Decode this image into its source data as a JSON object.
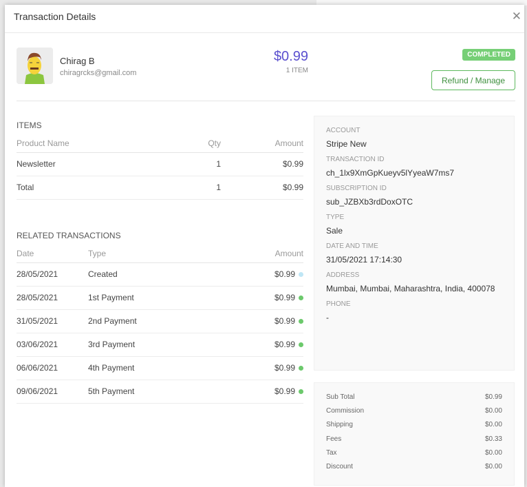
{
  "title": "Transaction Details",
  "customer": {
    "name": "Chirag B",
    "email": "chiragrcks@gmail.com"
  },
  "amount": "$0.99",
  "item_count": "1 ITEM",
  "status": "COMPLETED",
  "refund_label": "Refund / Manage",
  "items": {
    "heading": "ITEMS",
    "headers": [
      "Product Name",
      "Qty",
      "Amount"
    ],
    "rows": [
      {
        "name": "Newsletter",
        "qty": "1",
        "amount": "$0.99"
      },
      {
        "name": "Total",
        "qty": "1",
        "amount": "$0.99"
      }
    ]
  },
  "related": {
    "heading": "RELATED TRANSACTIONS",
    "headers": [
      "Date",
      "Type",
      "Amount"
    ],
    "rows": [
      {
        "date": "28/05/2021",
        "type": "Created",
        "amount": "$0.99",
        "color": "#bfe6f5"
      },
      {
        "date": "28/05/2021",
        "type": "1st Payment",
        "amount": "$0.99",
        "color": "#6cc96c"
      },
      {
        "date": "31/05/2021",
        "type": "2nd Payment",
        "amount": "$0.99",
        "color": "#6cc96c"
      },
      {
        "date": "03/06/2021",
        "type": "3rd Payment",
        "amount": "$0.99",
        "color": "#6cc96c"
      },
      {
        "date": "06/06/2021",
        "type": "4th Payment",
        "amount": "$0.99",
        "color": "#6cc96c"
      },
      {
        "date": "09/06/2021",
        "type": "5th Payment",
        "amount": "$0.99",
        "color": "#6cc96c"
      }
    ]
  },
  "details": [
    {
      "label": "ACCOUNT",
      "value": "Stripe New"
    },
    {
      "label": "TRANSACTION ID",
      "value": "ch_1lx9XmGpKueyv5lYyeaW7ms7"
    },
    {
      "label": "SUBSCRIPTION ID",
      "value": "sub_JZBXb3rdDoxOTC"
    },
    {
      "label": "TYPE",
      "value": "Sale"
    },
    {
      "label": "DATE AND TIME",
      "value": "31/05/2021 17:14:30"
    },
    {
      "label": "ADDRESS",
      "value": "Mumbai, Mumbai, Maharashtra, India, 400078"
    },
    {
      "label": "PHONE",
      "value": "-"
    }
  ],
  "summary": [
    {
      "label": "Sub Total",
      "value": "$0.99"
    },
    {
      "label": "Commission",
      "value": "$0.00"
    },
    {
      "label": "Shipping",
      "value": "$0.00"
    },
    {
      "label": "Fees",
      "value": "$0.33"
    },
    {
      "label": "Tax",
      "value": "$0.00"
    },
    {
      "label": "Discount",
      "value": "$0.00"
    }
  ]
}
